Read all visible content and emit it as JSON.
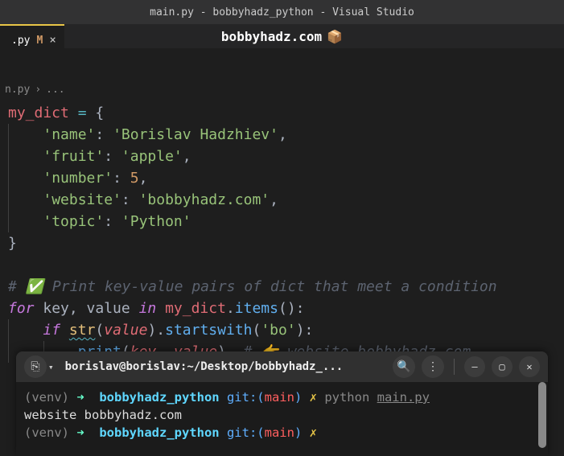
{
  "window": {
    "title": "main.py - bobbyhadz_python - Visual Studio"
  },
  "watermark": {
    "text": "bobbyhadz.com",
    "emoji": "📦"
  },
  "tab": {
    "filename": ".py",
    "modified": "M",
    "close": "×"
  },
  "breadcrumb": {
    "file": "n.py",
    "sep": "›",
    "rest": "..."
  },
  "code": {
    "l1_var": "my_dict",
    "l1_eq": " = ",
    "l1_brace": "{",
    "l2_key": "'name'",
    "l2_colon": ": ",
    "l2_val": "'Borislav Hadzhiev'",
    "l2_comma": ",",
    "l3_key": "'fruit'",
    "l3_colon": ": ",
    "l3_val": "'apple'",
    "l3_comma": ",",
    "l4_key": "'number'",
    "l4_colon": ": ",
    "l4_val": "5",
    "l4_comma": ",",
    "l5_key": "'website'",
    "l5_colon": ": ",
    "l5_val": "'bobbyhadz.com'",
    "l5_comma": ",",
    "l6_key": "'topic'",
    "l6_colon": ": ",
    "l6_val": "'Python'",
    "l7_brace": "}",
    "l8_comment": "# ✅ Print key-value pairs of dict that meet a condition",
    "l9_for": "for",
    "l9_vars": " key, value ",
    "l9_in": "in",
    "l9_obj": " my_dict",
    "l9_dot": ".",
    "l9_method": "items",
    "l9_par": "()",
    "l9_colon": ":",
    "l10_if": "if",
    "l10_sp": " ",
    "l10_str": "str",
    "l10_lp": "(",
    "l10_arg": "value",
    "l10_rp": ")",
    "l10_dot": ".",
    "l10_meth": "startswith",
    "l10_lp2": "(",
    "l10_s": "'bo'",
    "l10_rp2": ")",
    "l10_colon": ":",
    "l11_print": "print",
    "l11_lp": "(",
    "l11_a1": "key",
    "l11_c": ", ",
    "l11_a2": "value",
    "l11_rp": ")",
    "l11_sp": "  ",
    "l11_comment": "# 👉 website bobbyhadz.com"
  },
  "terminal": {
    "icon": "⎘",
    "drop": "▾",
    "title": "borislav@borislav:~/Desktop/bobbyhadz_...",
    "search": "🔍",
    "menu": "⋮",
    "min": "—",
    "max": "▢",
    "close": "✕",
    "lines": {
      "l1_venv": "(venv)",
      "l1_arrow": " ➜  ",
      "l1_path": "bobbyhadz_python",
      "l1_git": " git:(",
      "l1_branch": "main",
      "l1_gitend": ")",
      "l1_x": " ✗ ",
      "l1_cmd": "python ",
      "l1_file": "main.py",
      "l2_out": "website bobbyhadz.com",
      "l3_venv": "(venv)",
      "l3_arrow": " ➜  ",
      "l3_path": "bobbyhadz_python",
      "l3_git": " git:(",
      "l3_branch": "main",
      "l3_gitend": ")",
      "l3_x": " ✗ "
    }
  }
}
